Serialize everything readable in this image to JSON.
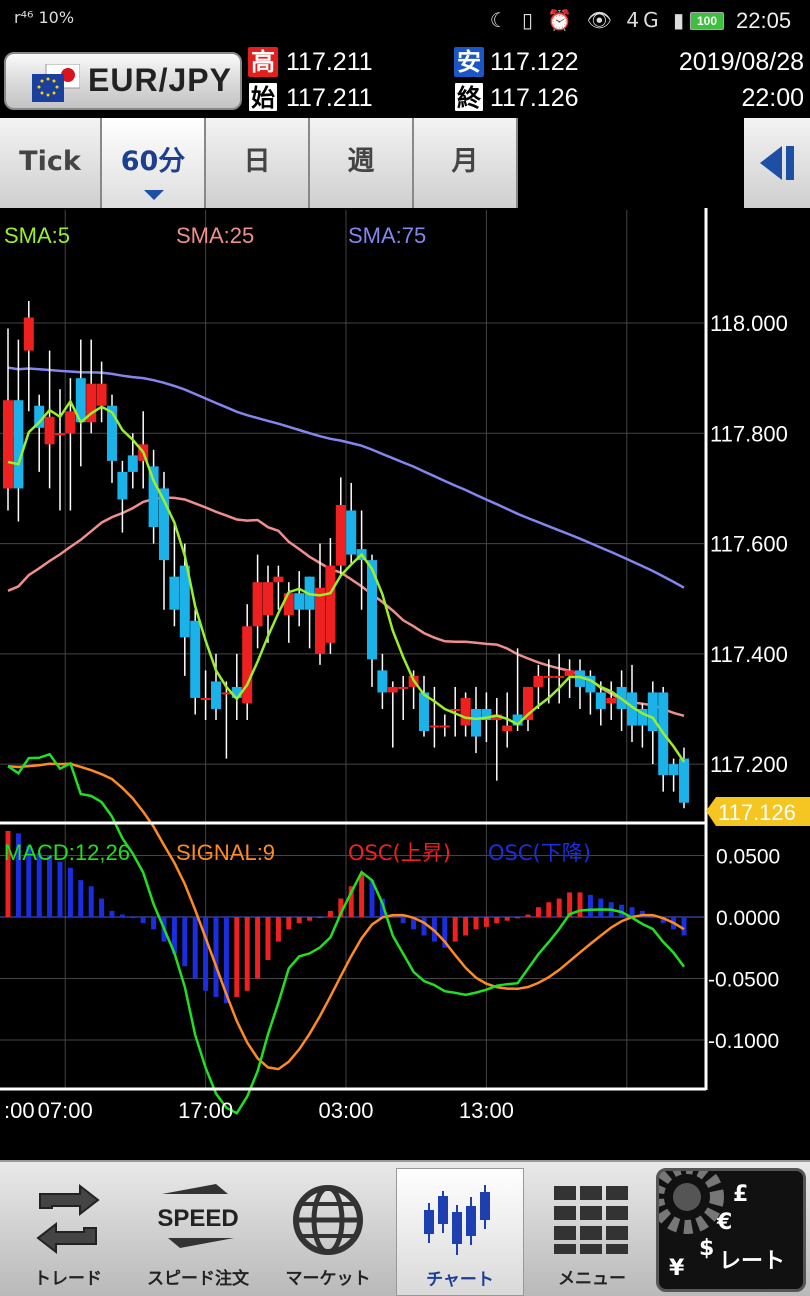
{
  "status_bar": {
    "left_icons": "r⁴⁶ 10%",
    "right_icons": "☾ ▯ ⏰ 👁 4G ▮▮▮",
    "battery": "100",
    "time": "22:05"
  },
  "header": {
    "pair": "EUR/JPY",
    "high_label": "高",
    "high": "117.211",
    "low_label": "安",
    "low": "117.122",
    "open_label": "始",
    "open": "117.211",
    "close_label": "終",
    "close": "117.126",
    "date": "2019/08/28",
    "time": "22:00"
  },
  "tabs": [
    {
      "label": "Tick",
      "active": false
    },
    {
      "label": "60分",
      "active": true
    },
    {
      "label": "日",
      "active": false
    },
    {
      "label": "週",
      "active": false
    },
    {
      "label": "月",
      "active": false
    }
  ],
  "legend": {
    "sma5": "SMA:5",
    "sma25": "SMA:25",
    "sma75": "SMA:75"
  },
  "macd_legend": {
    "macd": "MACD:12,26",
    "signal": "SIGNAL:9",
    "osc_up": "OSC(上昇)",
    "osc_down": "OSC(下降)"
  },
  "colors": {
    "candle_up": "#ee2020",
    "candle_down": "#1ab2e8",
    "sma5": "#9aee2a",
    "sma25": "#f08d8d",
    "sma75": "#8585f0",
    "macd": "#20e020",
    "signal": "#ff8a20",
    "osc_up": "#ee2020",
    "osc_down": "#1a2ee0",
    "price_tag": "#f5c522"
  },
  "chart_data": [
    {
      "type": "candlestick",
      "y_ticks": [
        "118.000",
        "117.800",
        "117.600",
        "117.400",
        "117.200"
      ],
      "ylim": [
        117.095,
        118.205
      ],
      "x_ticks": [
        ":00",
        "07:00",
        "17:00",
        "03:00",
        "13:00"
      ],
      "current_price": "117.126",
      "candles": [
        [
          117.7,
          117.86,
          117.66,
          117.99
        ],
        [
          117.86,
          117.7,
          117.64,
          117.97
        ],
        [
          117.95,
          118.01,
          117.84,
          118.04
        ],
        [
          117.85,
          117.81,
          117.73,
          117.87
        ],
        [
          117.78,
          117.83,
          117.7,
          117.95
        ],
        [
          117.8,
          117.8,
          117.66,
          117.88
        ],
        [
          117.8,
          117.84,
          117.66,
          117.9
        ],
        [
          117.9,
          117.82,
          117.74,
          117.97
        ],
        [
          117.82,
          117.89,
          117.8,
          117.97
        ],
        [
          117.85,
          117.89,
          117.82,
          117.93
        ],
        [
          117.85,
          117.75,
          117.71,
          117.87
        ],
        [
          117.73,
          117.68,
          117.62,
          117.75
        ],
        [
          117.76,
          117.73,
          117.7,
          117.8
        ],
        [
          117.75,
          117.78,
          117.7,
          117.84
        ],
        [
          117.74,
          117.63,
          117.6,
          117.77
        ],
        [
          117.7,
          117.57,
          117.48,
          117.73
        ],
        [
          117.54,
          117.48,
          117.45,
          117.64
        ],
        [
          117.56,
          117.43,
          117.36,
          117.6
        ],
        [
          117.46,
          117.32,
          117.29,
          117.48
        ],
        [
          117.32,
          117.32,
          117.28,
          117.37
        ],
        [
          117.35,
          117.3,
          117.28,
          117.4
        ],
        [
          117.33,
          117.33,
          117.21,
          117.35
        ],
        [
          117.34,
          117.32,
          117.28,
          117.4
        ],
        [
          117.31,
          117.45,
          117.28,
          117.49
        ],
        [
          117.45,
          117.53,
          117.41,
          117.58
        ],
        [
          117.47,
          117.53,
          117.42,
          117.56
        ],
        [
          117.53,
          117.54,
          117.48,
          117.56
        ],
        [
          117.47,
          117.51,
          117.42,
          117.53
        ],
        [
          117.51,
          117.48,
          117.45,
          117.55
        ],
        [
          117.54,
          117.48,
          117.41,
          117.54
        ],
        [
          117.4,
          117.52,
          117.38,
          117.6
        ],
        [
          117.42,
          117.56,
          117.4,
          117.61
        ],
        [
          117.56,
          117.67,
          117.54,
          117.72
        ],
        [
          117.66,
          117.58,
          117.56,
          117.71
        ],
        [
          117.59,
          117.57,
          117.48,
          117.66
        ],
        [
          117.57,
          117.39,
          117.34,
          117.58
        ],
        [
          117.37,
          117.33,
          117.3,
          117.4
        ],
        [
          117.33,
          117.34,
          117.23,
          117.35
        ],
        [
          117.34,
          117.34,
          117.28,
          117.36
        ],
        [
          117.34,
          117.36,
          117.3,
          117.37
        ],
        [
          117.33,
          117.26,
          117.25,
          117.36
        ],
        [
          117.27,
          117.27,
          117.23,
          117.34
        ],
        [
          117.27,
          117.27,
          117.25,
          117.29
        ],
        [
          117.3,
          117.3,
          117.25,
          117.34
        ],
        [
          117.27,
          117.32,
          117.25,
          117.33
        ],
        [
          117.3,
          117.25,
          117.22,
          117.34
        ],
        [
          117.3,
          117.28,
          117.24,
          117.33
        ],
        [
          117.28,
          117.29,
          117.17,
          117.32
        ],
        [
          117.26,
          117.27,
          117.23,
          117.33
        ],
        [
          117.29,
          117.27,
          117.26,
          117.41
        ],
        [
          117.28,
          117.34,
          117.26,
          117.34
        ],
        [
          117.34,
          117.36,
          117.3,
          117.38
        ],
        [
          117.36,
          117.36,
          117.31,
          117.39
        ],
        [
          117.36,
          117.36,
          117.31,
          117.4
        ],
        [
          117.36,
          117.37,
          117.32,
          117.39
        ],
        [
          117.37,
          117.34,
          117.3,
          117.39
        ],
        [
          117.36,
          117.33,
          117.29,
          117.37
        ],
        [
          117.33,
          117.3,
          117.27,
          117.35
        ],
        [
          117.31,
          117.32,
          117.28,
          117.35
        ],
        [
          117.34,
          117.3,
          117.26,
          117.37
        ],
        [
          117.33,
          117.27,
          117.24,
          117.38
        ],
        [
          117.3,
          117.27,
          117.23,
          117.31
        ],
        [
          117.33,
          117.26,
          117.2,
          117.35
        ],
        [
          117.33,
          117.18,
          117.15,
          117.34
        ],
        [
          117.2,
          117.18,
          117.15,
          117.21
        ],
        [
          117.21,
          117.13,
          117.12,
          117.23
        ]
      ]
    },
    {
      "type": "line-bar",
      "y_ticks": [
        "0.0500",
        "0.0000",
        "-0.0500",
        "-0.1000"
      ],
      "ylim": [
        -0.139,
        0.074
      ],
      "osc": [
        0.07,
        0.068,
        0.058,
        0.052,
        0.05,
        0.045,
        0.04,
        0.03,
        0.025,
        0.015,
        0.005,
        0.002,
        -0.001,
        -0.005,
        -0.01,
        -0.02,
        -0.03,
        -0.04,
        -0.05,
        -0.06,
        -0.065,
        -0.07,
        -0.065,
        -0.06,
        -0.05,
        -0.035,
        -0.02,
        -0.01,
        -0.005,
        -0.003,
        0.0,
        0.005,
        0.015,
        0.025,
        0.035,
        0.03,
        0.015,
        0.0,
        -0.005,
        -0.01,
        -0.015,
        -0.02,
        -0.025,
        -0.02,
        -0.015,
        -0.01,
        -0.008,
        -0.005,
        -0.003,
        -0.001,
        0.002,
        0.008,
        0.012,
        0.015,
        0.02,
        0.02,
        0.018,
        0.015,
        0.012,
        0.01,
        0.008,
        0.005,
        -0.001,
        -0.005,
        -0.01,
        -0.015
      ]
    }
  ],
  "nav": [
    {
      "label": "トレード",
      "active": false
    },
    {
      "label": "スピード注文",
      "active": false
    },
    {
      "label": "マーケット",
      "active": false
    },
    {
      "label": "チャート",
      "active": true
    },
    {
      "label": "メニュー",
      "active": false
    },
    {
      "label": "レート",
      "active": false
    }
  ],
  "nav_icon_text": {
    "speed": "SPEED"
  }
}
